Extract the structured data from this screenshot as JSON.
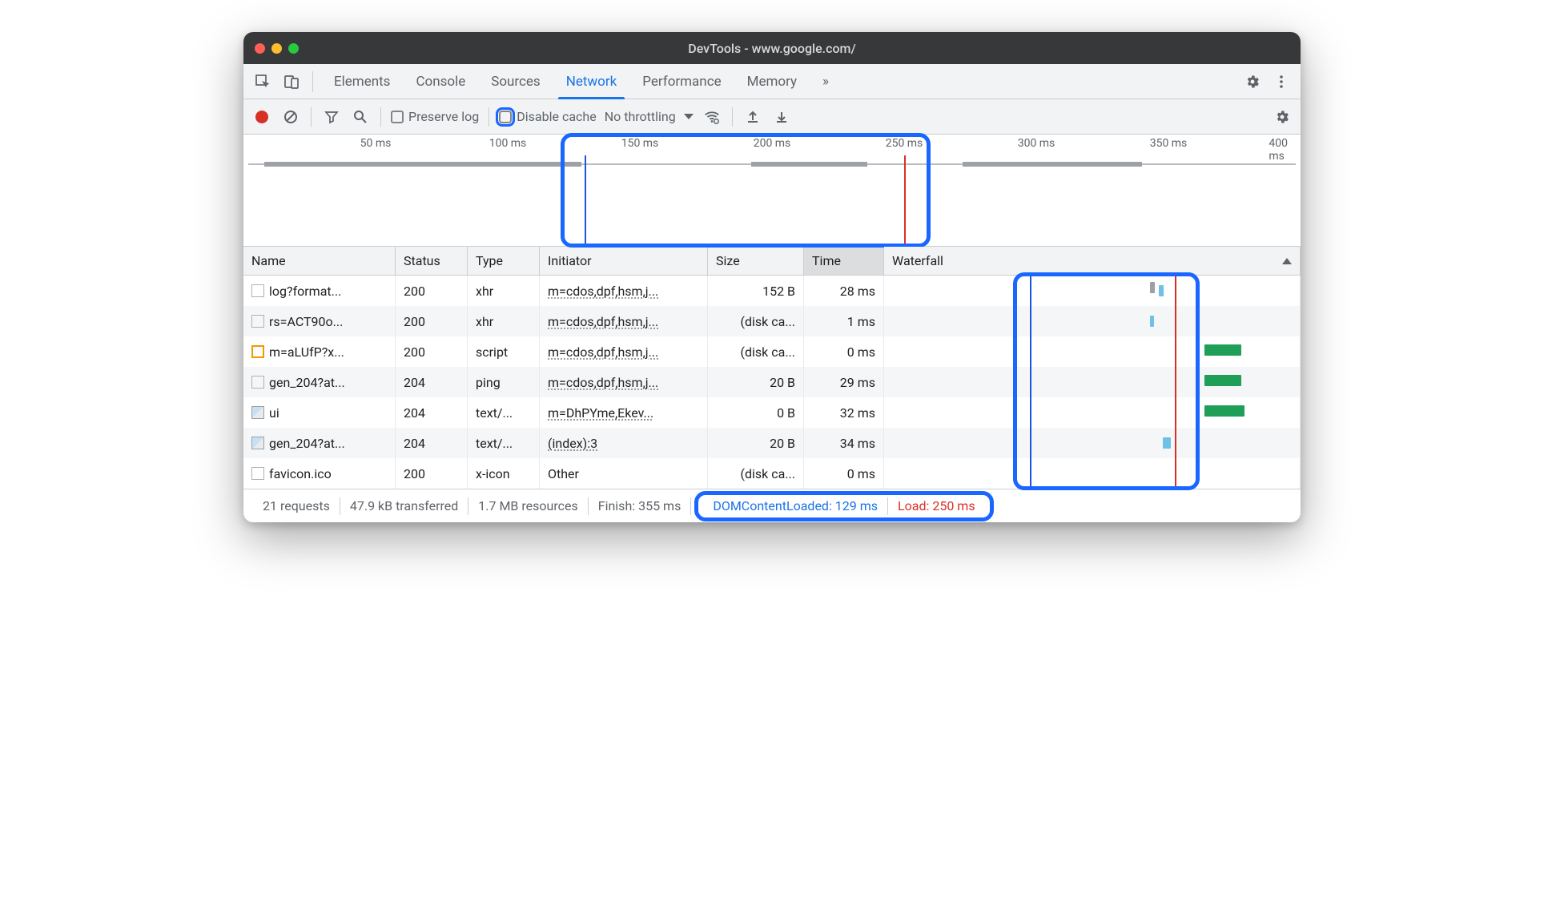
{
  "window": {
    "title": "DevTools - www.google.com/"
  },
  "tabs": [
    "Elements",
    "Console",
    "Sources",
    "Network",
    "Performance",
    "Memory"
  ],
  "activeTab": "Network",
  "toolbar": {
    "preserve_label": "Preserve log",
    "disable_cache_label": "Disable cache",
    "throttle_label": "No throttling"
  },
  "overview": {
    "ticks": [
      "50 ms",
      "100 ms",
      "150 ms",
      "200 ms",
      "250 ms",
      "300 ms",
      "350 ms",
      "400 ms"
    ]
  },
  "columns": {
    "name": "Name",
    "status": "Status",
    "type": "Type",
    "initiator": "Initiator",
    "size": "Size",
    "time": "Time",
    "waterfall": "Waterfall"
  },
  "rows": [
    {
      "name": "log?format...",
      "status": "200",
      "type": "xhr",
      "initiator": "m=cdos,dpf,hsm,j...",
      "size": "152 B",
      "time": "28 ms",
      "icon": "doc"
    },
    {
      "name": "rs=ACT90o...",
      "status": "200",
      "type": "xhr",
      "initiator": "m=cdos,dpf,hsm,j...",
      "size": "(disk ca...",
      "time": "1 ms",
      "icon": "doc"
    },
    {
      "name": "m=aLUfP?x...",
      "status": "200",
      "type": "script",
      "initiator": "m=cdos,dpf,hsm,j...",
      "size": "(disk ca...",
      "time": "0 ms",
      "icon": "js"
    },
    {
      "name": "gen_204?at...",
      "status": "204",
      "type": "ping",
      "initiator": "m=cdos,dpf,hsm,j...",
      "size": "20 B",
      "time": "29 ms",
      "icon": "doc"
    },
    {
      "name": "ui",
      "status": "204",
      "type": "text/...",
      "initiator": "m=DhPYme,Ekev...",
      "size": "0 B",
      "time": "32 ms",
      "icon": "img"
    },
    {
      "name": "gen_204?at...",
      "status": "204",
      "type": "text/...",
      "initiator": "(index):3",
      "size": "20 B",
      "time": "34 ms",
      "icon": "img"
    },
    {
      "name": "favicon.ico",
      "status": "200",
      "type": "x-icon",
      "initiator": "Other",
      "size": "(disk ca...",
      "time": "0 ms",
      "icon": "doc"
    }
  ],
  "status": {
    "requests": "21 requests",
    "transferred": "47.9 kB transferred",
    "resources": "1.7 MB resources",
    "finish": "Finish: 355 ms",
    "dcl": "DOMContentLoaded: 129 ms",
    "load": "Load: 250 ms"
  }
}
